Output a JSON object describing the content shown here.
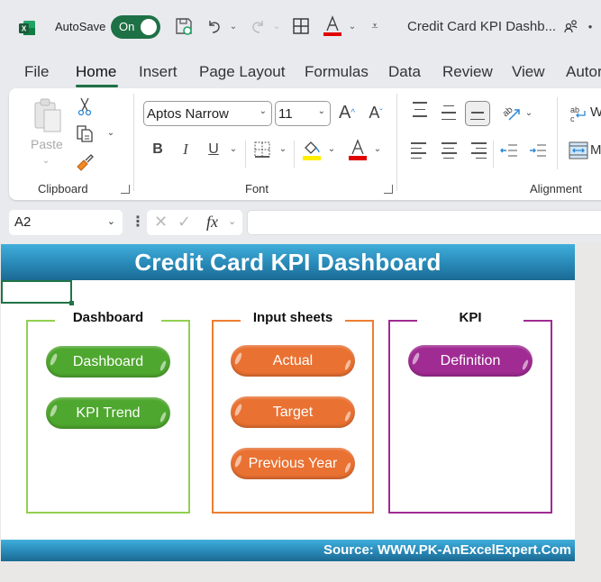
{
  "titlebar": {
    "autosave_label": "AutoSave",
    "autosave_state": "On",
    "document_title": "Credit Card KPI Dashb...",
    "icons": [
      "excel-logo-icon",
      "save-icon",
      "undo-icon",
      "redo-icon",
      "borders-icon",
      "font-color-icon",
      "customize-qat-icon",
      "share-people-icon"
    ]
  },
  "tabs": [
    {
      "label": "File"
    },
    {
      "label": "Home",
      "active": true
    },
    {
      "label": "Insert"
    },
    {
      "label": "Page Layout"
    },
    {
      "label": "Formulas"
    },
    {
      "label": "Data"
    },
    {
      "label": "Review"
    },
    {
      "label": "View"
    },
    {
      "label": "Autor"
    }
  ],
  "ribbon": {
    "clipboard": {
      "label": "Clipboard",
      "paste_label": "Paste"
    },
    "font": {
      "label": "Font",
      "font_name": "Aptos Narrow",
      "font_size": "11",
      "bold": "B",
      "italic": "I",
      "underline": "U",
      "fill_color": "#ffee00",
      "font_color": "#e00000"
    },
    "alignment": {
      "label": "Alignment",
      "wrap_label": "W",
      "merge_label": "M"
    }
  },
  "formula_bar": {
    "name_box": "A2",
    "fx_label": "fx",
    "formula_value": ""
  },
  "sheet": {
    "title": "Credit Card KPI Dashboard",
    "source": "Source: WWW.PK-AnExcelExpert.Com",
    "sections": [
      {
        "title": "Dashboard",
        "color": "#92d050",
        "button_color": "#4ea72e",
        "buttons": [
          "Dashboard",
          "KPI Trend"
        ]
      },
      {
        "title": "Input sheets",
        "color": "#ed7d31",
        "button_color": "#e97132",
        "buttons": [
          "Actual",
          "Target",
          "Previous Year"
        ]
      },
      {
        "title": "KPI",
        "color": "#a02b93",
        "button_color": "#a02b93",
        "buttons": [
          "Definition"
        ]
      }
    ]
  }
}
